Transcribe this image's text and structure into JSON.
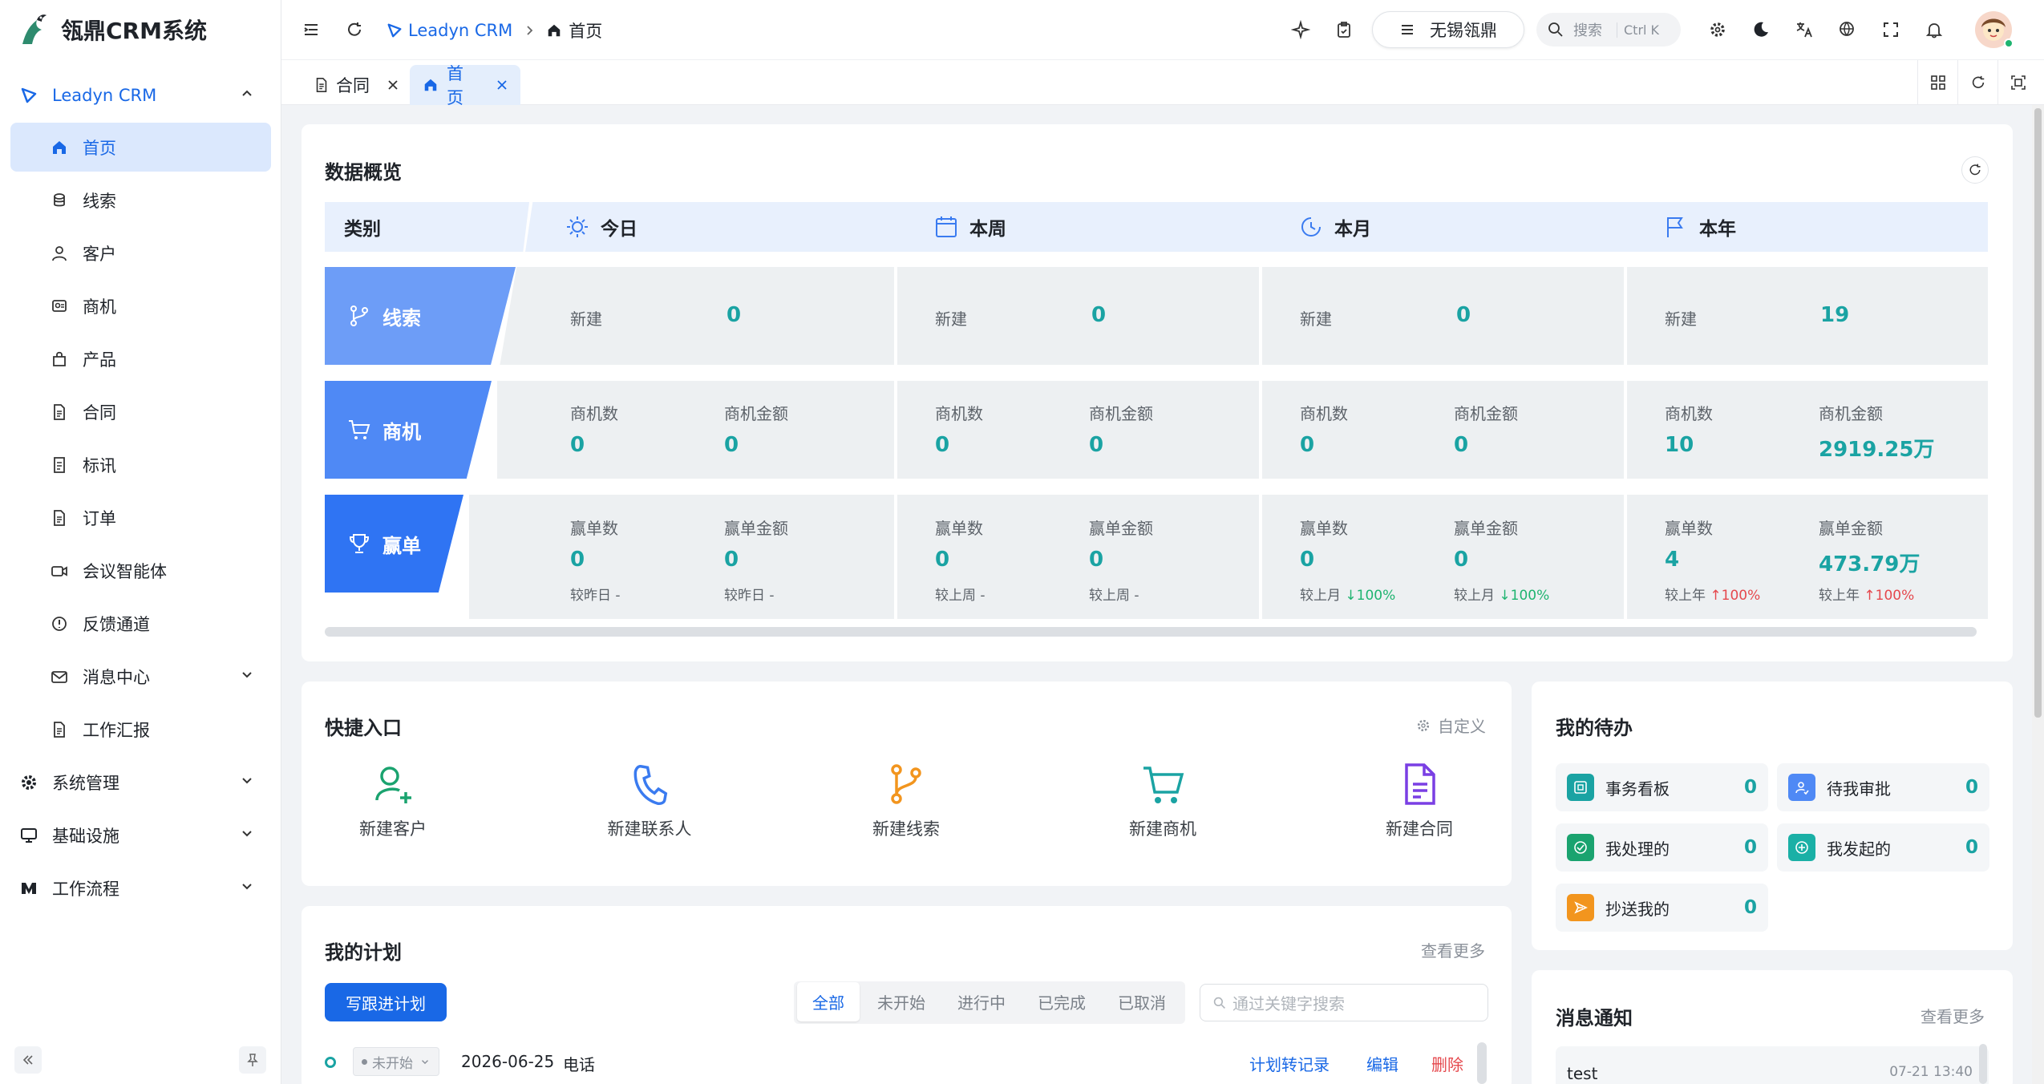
{
  "app": {
    "title": "瓴鼎CRM系统"
  },
  "sidebar": {
    "group_label": "Leadyn CRM",
    "items": [
      {
        "label": "首页",
        "icon": "home-icon"
      },
      {
        "label": "线索",
        "icon": "clue-icon"
      },
      {
        "label": "客户",
        "icon": "user-icon"
      },
      {
        "label": "商机",
        "icon": "opportunity-icon"
      },
      {
        "label": "产品",
        "icon": "product-icon"
      },
      {
        "label": "合同",
        "icon": "document-icon"
      },
      {
        "label": "标讯",
        "icon": "document-icon"
      },
      {
        "label": "订单",
        "icon": "document-icon"
      },
      {
        "label": "会议智能体",
        "icon": "video-icon"
      },
      {
        "label": "反馈通道",
        "icon": "info-icon"
      },
      {
        "label": "消息中心",
        "icon": "mail-icon"
      },
      {
        "label": "工作汇报",
        "icon": "document-icon"
      }
    ],
    "top_items": [
      {
        "label": "系统管理",
        "icon": "gear-icon"
      },
      {
        "label": "基础设施",
        "icon": "monitor-icon"
      },
      {
        "label": "工作流程",
        "icon": "workflow-icon"
      }
    ]
  },
  "header": {
    "breadcrumb": [
      "Leadyn CRM",
      "首页"
    ],
    "tenant": "无锡瓴鼎",
    "search_placeholder": "搜索",
    "search_shortcut": "Ctrl K"
  },
  "tabs": [
    {
      "label": "合同",
      "active": false
    },
    {
      "label": "首页",
      "active": true
    }
  ],
  "overview": {
    "title": "数据概览",
    "header": {
      "category": "类别",
      "periods": [
        "今日",
        "本周",
        "本月",
        "本年"
      ]
    },
    "rows": [
      {
        "label": "线索",
        "cells": [
          {
            "k1": "新建",
            "v1": "0"
          },
          {
            "k1": "新建",
            "v1": "0"
          },
          {
            "k1": "新建",
            "v1": "0"
          },
          {
            "k1": "新建",
            "v1": "19"
          }
        ]
      },
      {
        "label": "商机",
        "cells": [
          {
            "k1": "商机数",
            "v1": "0",
            "k2": "商机金额",
            "v2": "0"
          },
          {
            "k1": "商机数",
            "v1": "0",
            "k2": "商机金额",
            "v2": "0"
          },
          {
            "k1": "商机数",
            "v1": "0",
            "k2": "商机金额",
            "v2": "0"
          },
          {
            "k1": "商机数",
            "v1": "10",
            "k2": "商机金额",
            "v2": "2919.25万"
          }
        ]
      },
      {
        "label": "赢单",
        "cells": [
          {
            "k1": "赢单数",
            "v1": "0",
            "c1": "较昨日 -",
            "k2": "赢单金额",
            "v2": "0",
            "c2": "较昨日 -"
          },
          {
            "k1": "赢单数",
            "v1": "0",
            "c1": "较上周 -",
            "k2": "赢单金额",
            "v2": "0",
            "c2": "较上周 -"
          },
          {
            "k1": "赢单数",
            "v1": "0",
            "c1": "较上月",
            "c1d": "↓100%",
            "k2": "赢单金额",
            "v2": "0",
            "c2": "较上月",
            "c2d": "↓100%"
          },
          {
            "k1": "赢单数",
            "v1": "4",
            "c1": "较上年",
            "c1u": "↑100%",
            "k2": "赢单金额",
            "v2": "473.79万",
            "c2": "较上年",
            "c2u": "↑100%"
          }
        ]
      }
    ]
  },
  "quick": {
    "title": "快捷入口",
    "customize": "自定义",
    "items": [
      "新建客户",
      "新建联系人",
      "新建线索",
      "新建商机",
      "新建合同"
    ]
  },
  "todo": {
    "title": "我的待办",
    "items": [
      {
        "label": "事务看板",
        "count": "0"
      },
      {
        "label": "待我审批",
        "count": "0"
      },
      {
        "label": "我处理的",
        "count": "0"
      },
      {
        "label": "我发起的",
        "count": "0"
      },
      {
        "label": "抄送我的",
        "count": "0"
      }
    ]
  },
  "plan": {
    "title": "我的计划",
    "more": "查看更多",
    "write_btn": "写跟进计划",
    "filters": [
      "全部",
      "未开始",
      "进行中",
      "已完成",
      "已取消"
    ],
    "search_placeholder": "通过关键字搜索",
    "row": {
      "status": "未开始",
      "date": "2026-06-25",
      "type": "电话",
      "actions": [
        "计划转记录",
        "编辑",
        "删除"
      ]
    }
  },
  "notice": {
    "title": "消息通知",
    "more": "查看更多",
    "item": {
      "title": "test",
      "time": "07-21 13:40"
    }
  },
  "colors": {
    "primary": "#1968e6",
    "teal": "#1aa3a3",
    "danger": "#e5484d",
    "success": "#1fb470"
  }
}
